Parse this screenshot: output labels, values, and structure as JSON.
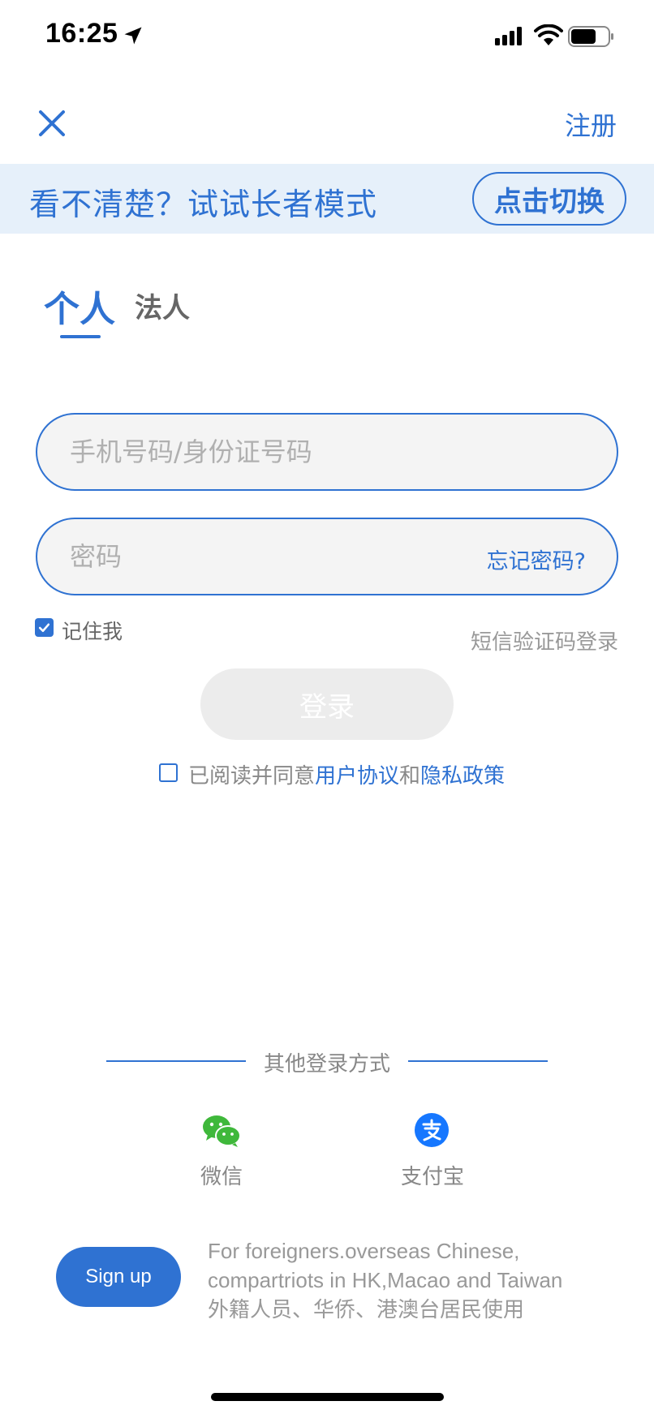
{
  "status_bar": {
    "time": "16:25"
  },
  "nav": {
    "register_label": "注册"
  },
  "elder_banner": {
    "text": "看不清楚？试试长者模式",
    "switch_label": "点击切换"
  },
  "tabs": [
    {
      "label": "个人",
      "active": true
    },
    {
      "label": "法人",
      "active": false
    }
  ],
  "form": {
    "phone_placeholder": "手机号码/身份证号码",
    "password_placeholder": "密码",
    "forgot_label": "忘记密码?",
    "remember_label": "记住我",
    "remember_checked": true,
    "sms_login_label": "短信验证码登录",
    "login_label": "登录",
    "agree_prefix": "已阅读并同意",
    "agree_user_link": "用户协议",
    "agree_and": "和",
    "agree_privacy_link": "隐私政策",
    "agree_checked": false
  },
  "other_login": {
    "title": "其他登录方式",
    "methods": [
      {
        "label": "微信",
        "icon": "wechat-icon"
      },
      {
        "label": "支付宝",
        "icon": "alipay-icon"
      }
    ]
  },
  "foreign": {
    "signup_label": "Sign up",
    "note_line1": "For foreigners.overseas Chinese,",
    "note_line2": "compartriots in HK,Macao and Taiwan",
    "note_line3": "外籍人员、华侨、港澳台居民使用"
  },
  "colors": {
    "accent": "#2f72d2",
    "banner_bg": "#e6f0fa",
    "wechat": "#3fb83b",
    "alipay": "#1677ff"
  }
}
